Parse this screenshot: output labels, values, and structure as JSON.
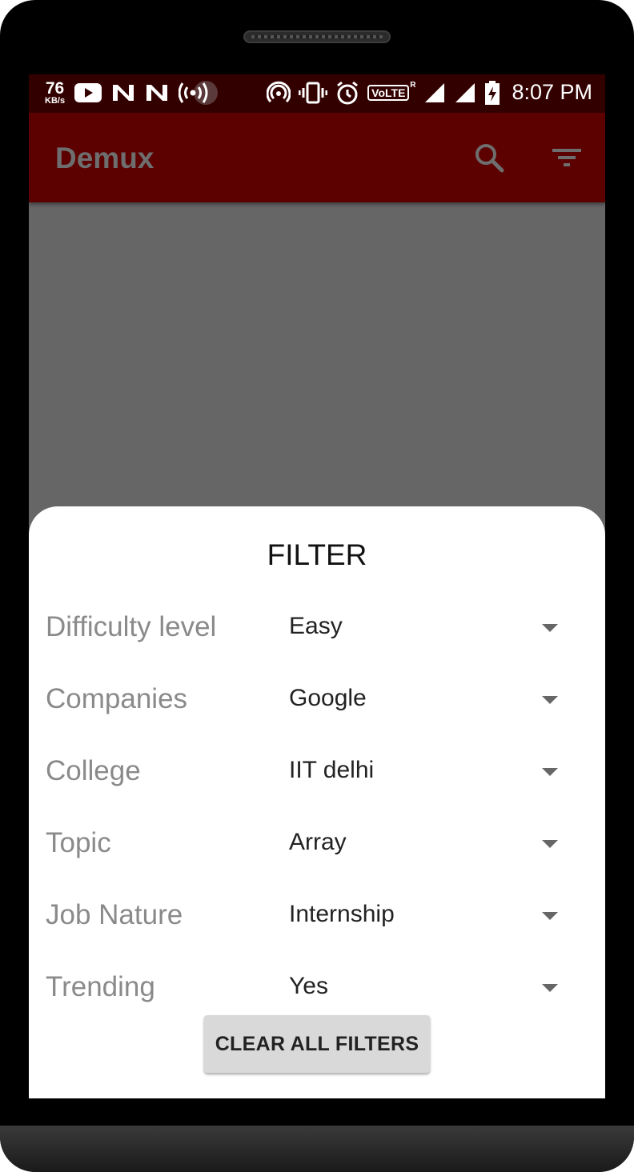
{
  "status_bar": {
    "net_speed": "76",
    "net_speed_unit": "KB/s",
    "volte_label": "VoLTE",
    "roaming_label": "R",
    "time": "8:07 PM"
  },
  "app_bar": {
    "title": "Demux",
    "actions": [
      "search-icon",
      "filter-icon"
    ]
  },
  "filter_sheet": {
    "title": "FILTER",
    "filters": [
      {
        "label": "Difficulty level",
        "value": "Easy"
      },
      {
        "label": "Companies",
        "value": "Google"
      },
      {
        "label": "College",
        "value": "IIT delhi"
      },
      {
        "label": "Topic",
        "value": "Array"
      },
      {
        "label": "Job Nature",
        "value": "Internship"
      },
      {
        "label": "Trending",
        "value": "Yes"
      }
    ],
    "clear_button": "CLEAR ALL FILTERS"
  },
  "colors": {
    "status_bar": "#330000",
    "app_bar": "#5c0000",
    "scrim": "#666666",
    "sheet": "#ffffff"
  }
}
